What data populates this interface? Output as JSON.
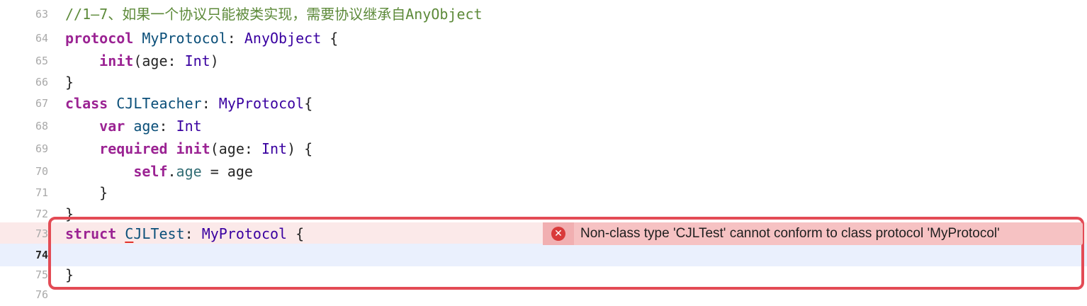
{
  "editor": {
    "lines": [
      {
        "number": "63",
        "segments": [
          {
            "t": "//1–7、如果一个协议只能被类实现，需要协议继承自AnyObject",
            "c": "cm"
          }
        ]
      },
      {
        "number": "64",
        "segments": [
          {
            "t": "protocol",
            "c": "kw"
          },
          {
            "t": " ",
            "c": "plain"
          },
          {
            "t": "MyProtocol",
            "c": "decl"
          },
          {
            "t": ": ",
            "c": "plain"
          },
          {
            "t": "AnyObject",
            "c": "ty"
          },
          {
            "t": " {",
            "c": "plain"
          }
        ]
      },
      {
        "number": "65",
        "segments": [
          {
            "t": "    ",
            "c": "plain"
          },
          {
            "t": "init",
            "c": "kw"
          },
          {
            "t": "(age: ",
            "c": "plain"
          },
          {
            "t": "Int",
            "c": "ty"
          },
          {
            "t": ")",
            "c": "plain"
          }
        ]
      },
      {
        "number": "66",
        "segments": [
          {
            "t": "}",
            "c": "plain"
          }
        ]
      },
      {
        "number": "67",
        "segments": [
          {
            "t": "class",
            "c": "kw"
          },
          {
            "t": " ",
            "c": "plain"
          },
          {
            "t": "CJLTeacher",
            "c": "decl"
          },
          {
            "t": ": ",
            "c": "plain"
          },
          {
            "t": "MyProtocol",
            "c": "ty"
          },
          {
            "t": "{",
            "c": "plain"
          }
        ]
      },
      {
        "number": "68",
        "segments": [
          {
            "t": "    ",
            "c": "plain"
          },
          {
            "t": "var",
            "c": "kw"
          },
          {
            "t": " ",
            "c": "plain"
          },
          {
            "t": "age",
            "c": "decl"
          },
          {
            "t": ": ",
            "c": "plain"
          },
          {
            "t": "Int",
            "c": "ty"
          }
        ]
      },
      {
        "number": "69",
        "segments": [
          {
            "t": "    ",
            "c": "plain"
          },
          {
            "t": "required",
            "c": "kw"
          },
          {
            "t": " ",
            "c": "plain"
          },
          {
            "t": "init",
            "c": "kw"
          },
          {
            "t": "(age: ",
            "c": "plain"
          },
          {
            "t": "Int",
            "c": "ty"
          },
          {
            "t": ") {",
            "c": "plain"
          }
        ]
      },
      {
        "number": "70",
        "segments": [
          {
            "t": "        ",
            "c": "plain"
          },
          {
            "t": "self",
            "c": "kw"
          },
          {
            "t": ".",
            "c": "plain"
          },
          {
            "t": "age",
            "c": "prop"
          },
          {
            "t": " = age",
            "c": "plain"
          }
        ]
      },
      {
        "number": "71",
        "segments": [
          {
            "t": "    }",
            "c": "plain"
          }
        ]
      },
      {
        "number": "72",
        "segments": [
          {
            "t": "}",
            "c": "plain"
          }
        ]
      },
      {
        "number": "73",
        "state": "error",
        "segments": [
          {
            "t": "struct",
            "c": "kw"
          },
          {
            "t": " ",
            "c": "plain"
          },
          {
            "t": "C",
            "c": "decl err-underline"
          },
          {
            "t": "JLTest",
            "c": "decl"
          },
          {
            "t": ": ",
            "c": "plain"
          },
          {
            "t": "MyProtocol",
            "c": "ty"
          },
          {
            "t": " {",
            "c": "plain"
          }
        ]
      },
      {
        "number": "74",
        "state": "current",
        "segments": []
      },
      {
        "number": "75",
        "segments": [
          {
            "t": "}",
            "c": "plain"
          }
        ]
      },
      {
        "number": "76",
        "segments": []
      }
    ]
  },
  "error": {
    "icon": "error-x-icon",
    "glyph": "✕",
    "message": "Non-class type 'CJLTest' cannot conform to class protocol 'MyProtocol'"
  },
  "colors": {
    "keyword": "#9b2393",
    "type": "#3900a0",
    "declaration": "#0b4f79",
    "comment": "#5d8a3a",
    "error_border": "#e34b55",
    "error_banner": "#f6c2c3",
    "current_line": "#eaf0fd"
  }
}
